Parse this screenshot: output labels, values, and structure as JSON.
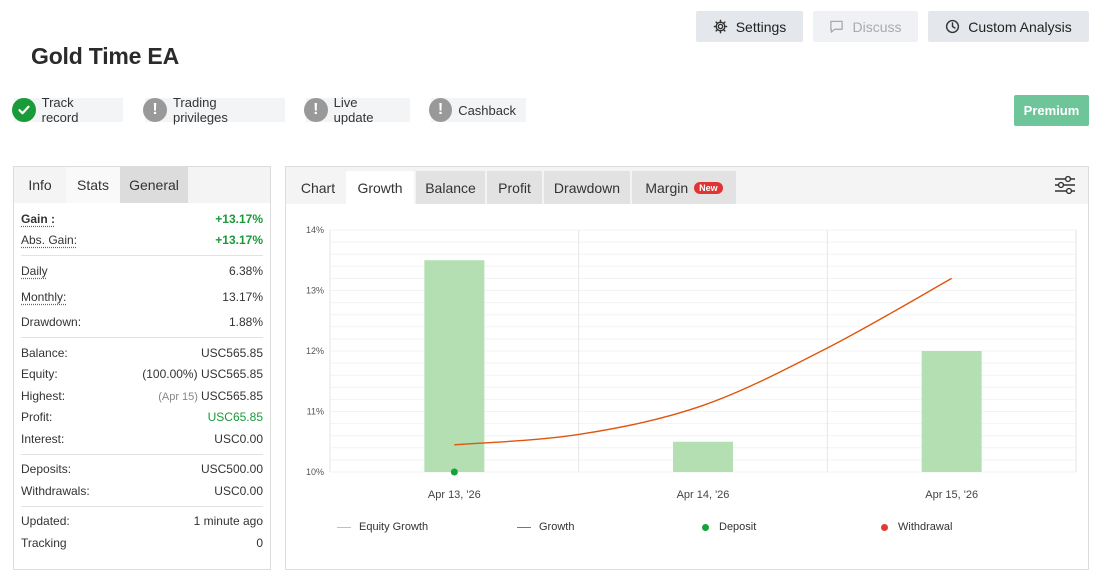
{
  "title": "Gold Time EA",
  "toolbar": {
    "settings_label": "Settings",
    "discuss_label": "Discuss",
    "custom_analysis_label": "Custom Analysis"
  },
  "premium_label": "Premium",
  "badges": [
    {
      "label": "Track record",
      "status": "ok"
    },
    {
      "label": "Trading privileges",
      "status": "warn"
    },
    {
      "label": "Live update",
      "status": "warn"
    },
    {
      "label": "Cashback",
      "status": "warn"
    }
  ],
  "left_tabs": [
    "Info",
    "Stats",
    "General"
  ],
  "stats": {
    "gain": {
      "label": "Gain :",
      "value": "+13.17%"
    },
    "abs_gain": {
      "label": "Abs. Gain:",
      "value": "+13.17%"
    },
    "daily": {
      "label": "Daily",
      "value": "6.38%"
    },
    "monthly": {
      "label": "Monthly:",
      "value": "13.17%"
    },
    "drawdown": {
      "label": "Drawdown:",
      "value": "1.88%"
    },
    "balance": {
      "label": "Balance:",
      "value": "USC565.85"
    },
    "equity": {
      "label": "Equity:",
      "note": "(100.00%)",
      "value": "USC565.85"
    },
    "highest": {
      "label": "Highest:",
      "note": "(Apr 15)",
      "value": "USC565.85"
    },
    "profit": {
      "label": "Profit:",
      "value": "USC65.85"
    },
    "interest": {
      "label": "Interest:",
      "value": "USC0.00"
    },
    "deposits": {
      "label": "Deposits:",
      "value": "USC500.00"
    },
    "withdrawals": {
      "label": "Withdrawals:",
      "value": "USC0.00"
    },
    "updated": {
      "label": "Updated:",
      "value": "1 minute ago"
    },
    "tracking": {
      "label": "Tracking",
      "value": "0"
    }
  },
  "chart_tabs": {
    "chart": "Chart",
    "growth": "Growth",
    "balance": "Balance",
    "profit": "Profit",
    "drawdown": "Drawdown",
    "margin": "Margin",
    "new_badge": "New"
  },
  "legend": {
    "equity_growth": "Equity Growth",
    "growth": "Growth",
    "deposit": "Deposit",
    "withdrawal": "Withdrawal"
  },
  "colors": {
    "accent_green": "#1a9b3a",
    "premium": "#6ec59a",
    "bar": "#b3dfb3",
    "growth_line": "#e0550f",
    "equity_line": "#e8c547",
    "deposit": "#13a338",
    "withdrawal": "#e53935"
  },
  "chart_data": {
    "type": "bar",
    "categories": [
      "Apr 13, '26",
      "Apr 14, '26",
      "Apr 15, '26"
    ],
    "series": [
      {
        "type": "bar",
        "values": [
          13.5,
          10.5,
          12.0
        ]
      },
      {
        "name": "Growth",
        "type": "line",
        "x": [
          0,
          0.5,
          1,
          1.5,
          2
        ],
        "values": [
          10.45,
          10.62,
          11.1,
          12.05,
          13.2
        ]
      }
    ],
    "deposits": [
      {
        "x": 0,
        "y": 10.0
      }
    ],
    "ylim": [
      10,
      14
    ],
    "yticks": [
      "10%",
      "11%",
      "12%",
      "13%",
      "14%"
    ],
    "grid": true,
    "legend_position": "bottom"
  }
}
